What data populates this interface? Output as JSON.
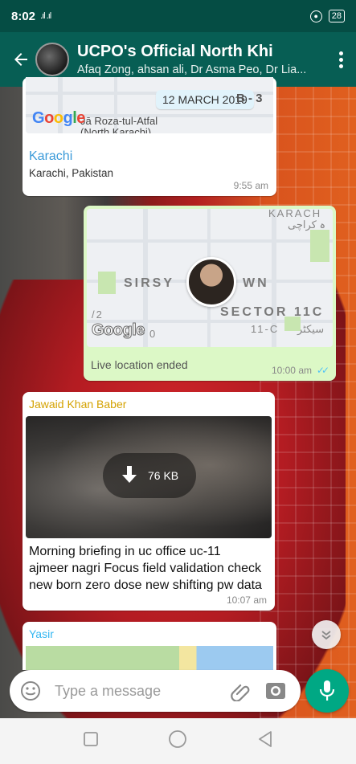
{
  "status_bar": {
    "time": "8:02",
    "signal": ".ıl .ıl",
    "battery": "28"
  },
  "app_bar": {
    "title": "UCPO's Official North Khi",
    "members": "Afaq Zong, ahsan ali, Dr Asma Peo, Dr Lia..."
  },
  "messages": [
    {
      "type": "location",
      "map_date_chip": "12 MARCH 2019",
      "map_sector": "B - 3",
      "map_place": "Jā Roza-tul-Atfal\n(North Karachi)",
      "map_logo": "Google",
      "location_name": "Karachi",
      "location_address": "Karachi, Pakistan",
      "time": "9:55 am"
    },
    {
      "type": "live_location",
      "map_labels": {
        "karachi": "KARACH",
        "karachi_urdu": "ہ کراچی",
        "area": "SIRSY",
        "area_suffix": "WN",
        "sector": "SECTOR 11C",
        "sector_sub": "11-C",
        "sector_urdu": "سیکٹر",
        "block": "/2",
        "block_sub": "0"
      },
      "map_logo": "Google",
      "status": "Live location ended",
      "time": "10:00 am",
      "ticks": "✓✓"
    },
    {
      "type": "image",
      "sender": "Jawaid Khan Baber",
      "sender_color": "#d4a200",
      "download_size": "76 KB",
      "caption": "Morning briefing in uc office uc-11 ajmeer nagri Focus field validation check new born zero dose new shifting pw data",
      "time": "10:07 am"
    },
    {
      "type": "image_partial",
      "sender": "Yasir",
      "sender_color": "#34b7f1"
    }
  ],
  "composer": {
    "placeholder": "Type a message",
    "value": ""
  },
  "colors": {
    "header": "#075e54",
    "status_bar": "#054d44",
    "accent": "#00a884",
    "outgoing": "#dcf8c6",
    "read_ticks": "#4fc3f7"
  },
  "icons": [
    "back-arrow-icon",
    "menu-dots-icon",
    "emoji-icon",
    "attach-icon",
    "camera-icon",
    "mic-icon",
    "download-icon",
    "chevron-down-icon",
    "nav-square-icon",
    "nav-home-icon",
    "nav-back-icon"
  ]
}
